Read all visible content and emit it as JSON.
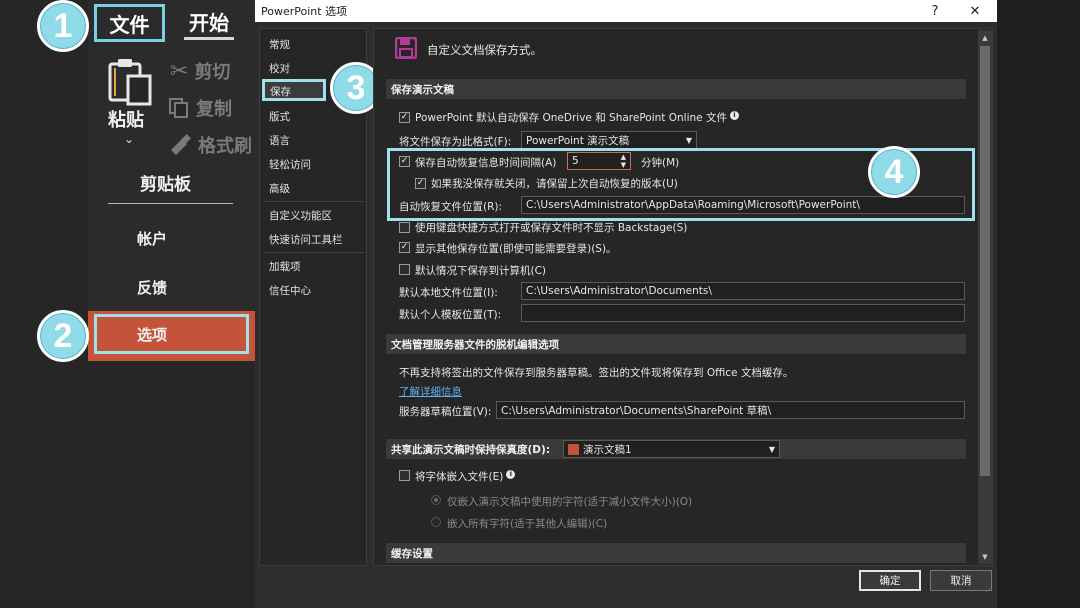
{
  "ribbon": {
    "tab_file": "文件",
    "tab_home": "开始",
    "paste": "粘贴",
    "cut": "剪切",
    "copy": "复制",
    "format_painter": "格式刷",
    "clipboard_group": "剪贴板"
  },
  "backstage": {
    "account": "帐户",
    "feedback": "反馈",
    "options": "选项"
  },
  "steps": [
    "1",
    "2",
    "3",
    "4"
  ],
  "dialog": {
    "title": "PowerPoint 选项",
    "help_btn": "?",
    "close_btn": "✕",
    "nav": {
      "items": [
        "常规",
        "校对",
        "保存",
        "版式",
        "语言",
        "轻松访问",
        "高级",
        "自定义功能区",
        "快速访问工具栏",
        "加载项",
        "信任中心"
      ],
      "selected": "保存"
    },
    "header_text": "自定义文档保存方式。",
    "save_section": {
      "title": "保存演示文稿",
      "autosave_onedrive": "PowerPoint 默认自动保存 OneDrive 和 SharePoint Online 文件",
      "save_format_label": "将文件保存为此格式(F):",
      "save_format_value": "PowerPoint 演示文稿",
      "autorecover_label": "保存自动恢复信息时间间隔(A)",
      "autorecover_minutes": "5",
      "minutes_label": "分钟(M)",
      "keep_last_label": "如果我没保存就关闭，请保留上次自动恢复的版本(U)",
      "autorecover_location_label": "自动恢复文件位置(R):",
      "autorecover_location_value": "C:\\Users\\Administrator\\AppData\\Roaming\\Microsoft\\PowerPoint\\",
      "no_backstage_label": "使用键盘快捷方式打开或保存文件时不显示 Backstage(S)",
      "show_additional_label": "显示其他保存位置(即使可能需要登录)(S)。",
      "save_to_computer_label": "默认情况下保存到计算机(C)",
      "default_local_label": "默认本地文件位置(I):",
      "default_local_value": "C:\\Users\\Administrator\\Documents\\",
      "default_template_label": "默认个人模板位置(T):",
      "default_template_value": ""
    },
    "offline_section": {
      "title": "文档管理服务器文件的脱机编辑选项",
      "description": "不再支持将签出的文件保存到服务器草稿。签出的文件现将保存到 Office 文档缓存。",
      "learn_more": "了解详细信息",
      "drafts_label": "服务器草稿位置(V):",
      "drafts_value": "C:\\Users\\Administrator\\Documents\\SharePoint 草稿\\"
    },
    "fidelity_section": {
      "title": "共享此演示文稿时保持保真度(D):",
      "document": "演示文稿1",
      "embed_fonts_label": "将字体嵌入文件(E)",
      "embed_used_label": "仅嵌入演示文稿中使用的字符(适于减小文件大小)(O)",
      "embed_all_label": "嵌入所有字符(适于其他人编辑)(C)"
    },
    "cache_section": {
      "title": "缓存设置"
    },
    "ok_label": "确定",
    "cancel_label": "取消"
  },
  "colors": {
    "accent_cyan": "#9fe0ea",
    "options_orange": "#c5533a",
    "link_blue": "#5fb0f0",
    "save_icon_magenta": "#b5399b"
  }
}
